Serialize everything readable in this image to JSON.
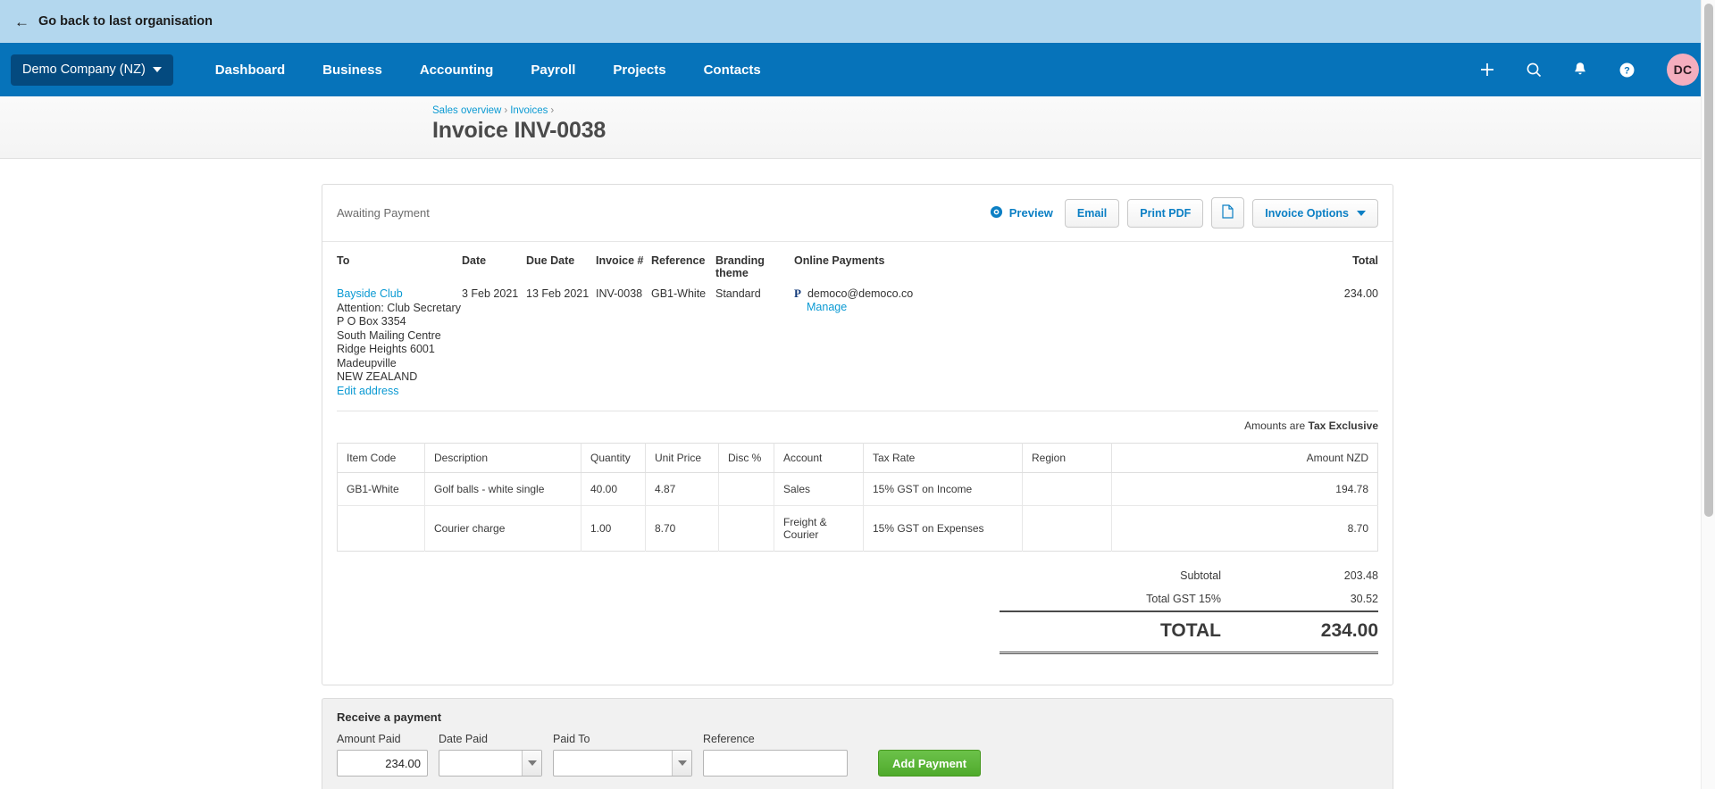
{
  "banner": {
    "back_label": "Go back to last organisation",
    "back_icon": "arrow-left-icon"
  },
  "nav": {
    "org_name": "Demo Company (NZ)",
    "items": [
      {
        "label": "Dashboard"
      },
      {
        "label": "Business"
      },
      {
        "label": "Accounting"
      },
      {
        "label": "Payroll"
      },
      {
        "label": "Projects"
      },
      {
        "label": "Contacts"
      }
    ],
    "icons": [
      {
        "name": "plus-icon",
        "glyph": "+"
      },
      {
        "name": "search-icon",
        "glyph": "search"
      },
      {
        "name": "bell-icon",
        "glyph": "bell"
      },
      {
        "name": "help-icon",
        "glyph": "?"
      }
    ],
    "avatar_initials": "DC",
    "avatar_color": "#f4aebe",
    "bar_color": "#0673ba"
  },
  "header": {
    "breadcrumb": [
      {
        "label": "Sales overview"
      },
      {
        "label": "Invoices"
      }
    ],
    "separator": "›",
    "title": "Invoice INV-0038"
  },
  "invoice": {
    "status": "Awaiting Payment",
    "actions": {
      "preview": "Preview",
      "email": "Email",
      "print_pdf": "Print PDF",
      "copy_icon": "document-copy-icon",
      "options": "Invoice Options"
    },
    "meta_headers": {
      "to": "To",
      "date": "Date",
      "due_date": "Due Date",
      "invoice_no": "Invoice #",
      "reference": "Reference",
      "branding_theme": "Branding theme",
      "online_payments": "Online Payments",
      "total": "Total"
    },
    "contact": {
      "name": "Bayside Club",
      "address": [
        "Attention: Club Secretary",
        "P O Box 3354",
        "South Mailing Centre",
        "Ridge Heights 6001",
        "Madeupville",
        "NEW ZEALAND"
      ],
      "edit_address": "Edit address"
    },
    "date": "3 Feb 2021",
    "due_date": "13 Feb 2021",
    "invoice_no": "INV-0038",
    "reference": "GB1-White",
    "branding_theme": "Standard",
    "online_payments": {
      "provider_icon": "paypal-icon",
      "email": "democo@democo.co",
      "manage": "Manage"
    },
    "header_total": "234.00",
    "tax_note_prefix": "Amounts are",
    "tax_note_value": "Tax Exclusive",
    "columns": [
      "Item Code",
      "Description",
      "Quantity",
      "Unit Price",
      "Disc %",
      "Account",
      "Tax Rate",
      "Region",
      "Amount NZD"
    ],
    "rows": [
      {
        "item_code": "GB1-White",
        "description": "Golf balls - white single",
        "quantity": "40.00",
        "unit_price": "4.87",
        "disc": "",
        "account": "Sales",
        "tax_rate": "15% GST on Income",
        "region": "",
        "amount": "194.78"
      },
      {
        "item_code": "",
        "description": "Courier charge",
        "quantity": "1.00",
        "unit_price": "8.70",
        "disc": "",
        "account": "Freight & Courier",
        "tax_rate": "15% GST on Expenses",
        "region": "",
        "amount": "8.70"
      }
    ],
    "totals": {
      "subtotal_label": "Subtotal",
      "subtotal_value": "203.48",
      "gst_label": "Total GST  15%",
      "gst_value": "30.52",
      "grand_label": "TOTAL",
      "grand_value": "234.00"
    }
  },
  "payment": {
    "title": "Receive a payment",
    "amount_label": "Amount Paid",
    "amount_value": "234.00",
    "date_label": "Date Paid",
    "date_value": "",
    "paid_to_label": "Paid To",
    "paid_to_value": "",
    "reference_label": "Reference",
    "reference_value": "",
    "add_button": "Add Payment",
    "button_color": "#5cb733"
  }
}
